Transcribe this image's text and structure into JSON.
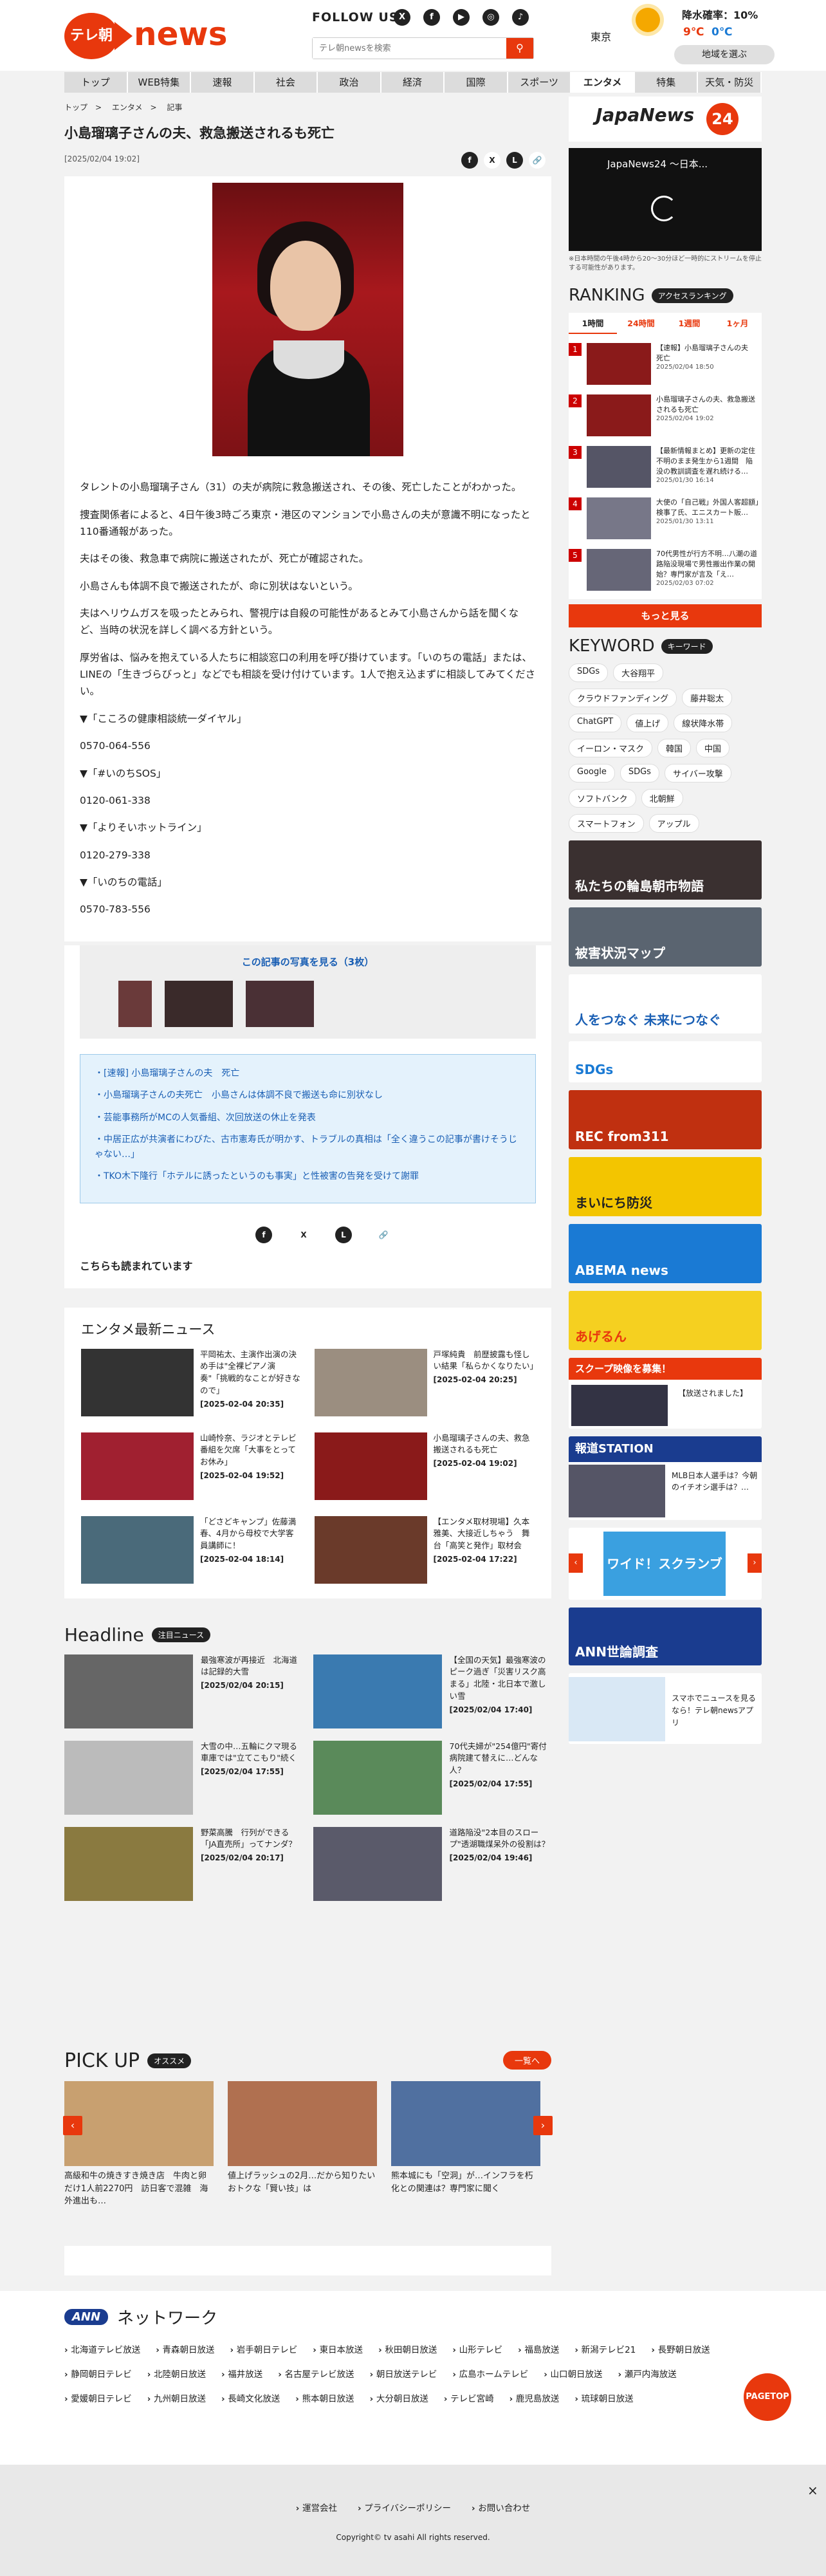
{
  "header": {
    "logo_badge": "テレ朝",
    "logo_word": "news",
    "follow": "FOLLOW US",
    "social": [
      "X",
      "f",
      "▶",
      "◎"
    ],
    "search_placeholder": "テレ朝newsを検索",
    "search_icon": "search-icon",
    "weather": {
      "city": "東京",
      "rain": "降水確率：10%",
      "high": "9℃",
      "low": "0℃",
      "change": "地域を選ぶ"
    }
  },
  "nav": [
    "トップ",
    "WEB特集",
    "速報",
    "社会",
    "政治",
    "経済",
    "国際",
    "スポーツ",
    "エンタメ",
    "特集",
    "天気・防災"
  ],
  "nav_active": "エンタメ",
  "breadcrumb": [
    "トップ",
    "エンタメ",
    "記事"
  ],
  "article": {
    "title": "小島瑠璃子さんの夫、救急搬送されるも死亡",
    "date": "[2025/02/04 19:02]",
    "paragraphs": [
      "タレントの小島瑠璃子さん（31）の夫が病院に救急搬送され、その後、死亡したことがわかった。",
      "捜査関係者によると、4日午後3時ごろ東京・港区のマンションで小島さんの夫が意識不明になったと110番通報があった。",
      "夫はその後、救急車で病院に搬送されたが、死亡が確認された。",
      "小島さんも体調不良で搬送されたが、命に別状はないという。",
      "夫はヘリウムガスを吸ったとみられ、警視庁は自殺の可能性があるとみて小島さんから話を聞くなど、当時の状況を詳しく調べる方針という。",
      "厚労省は、悩みを抱えている人たちに相談窓口の利用を呼び掛けています。「いのちの電話」または、LINEの「生きづらびっと」などでも相談を受け付けています。1人で抱え込まずに相談してみてください。",
      "▼「こころの健康相談統一ダイヤル」",
      "0570-064-556",
      "▼「#いのちSOS」",
      "0120-061-338",
      "▼「よりそいホットライン」",
      "0120-279-338",
      "▼「いのちの電話」",
      "0570-783-556"
    ],
    "photos_link": "この記事の写真を見る（3枚）",
    "related": [
      "・[速報] 小島瑠璃子さんの夫　死亡",
      "・小島瑠璃子さんの夫死亡　小島さんは体調不良で搬送も命に別状なし",
      "・芸能事務所がMCの人気番組、次回放送の休止を発表",
      "・中居正広が共演者にわびた、古市憲寿氏が明かす、トラブルの真相は「全く違うこの記事が書けそうじゃない…」",
      "・TKO木下隆行「ホテルに誘ったというのも事実」と性被害の告発を受けて謝罪"
    ],
    "read_also": "こちらも読まれています"
  },
  "entame": {
    "heading": "エンタメ最新ニュース",
    "items": [
      {
        "t": "平岡祐太、主演作出演の決め手は\"全裸ピアノ演奏\"「挑戦的なことが好きなので」",
        "d": "[2025-02-04 20:35]",
        "c": "#333"
      },
      {
        "t": "戸塚純貴　前歴披露も怪しい結果「私らかくなりたい」",
        "d": "[2025-02-04 20:25]",
        "c": "#9b8e80"
      },
      {
        "t": "山崎怜奈、ラジオとテレビ番組を欠席「大事をとってお休み」",
        "d": "[2025-02-04 19:52]",
        "c": "#a02030"
      },
      {
        "t": "小島瑠璃子さんの夫、救急搬送されるも死亡",
        "d": "[2025-02-04 19:02]",
        "c": "#8a1a1a"
      },
      {
        "t": "「どさどキャンプ」佐藤満春、4月から母校で大学客員講師に！",
        "d": "[2025-02-04 18:14]",
        "c": "#4a6a7a"
      },
      {
        "t": "【エンタメ取材現場】久本雅美、大接近しちゃう　舞台「高笑と発作」取材会",
        "d": "[2025-02-04 17:22]",
        "c": "#6a3a2a"
      }
    ]
  },
  "headline": {
    "heading": "Headline",
    "badge": "注目ニュース",
    "items": [
      {
        "t": "最強寒波が再接近　北海道は記録的大雪",
        "d": "[2025/02/04 20:15]",
        "c": "#666"
      },
      {
        "t": "【全国の天気】最強寒波のピーク過ぎ「災害リスク高まる」北陸・北日本で激しい雪",
        "d": "[2025/02/04 17:40]",
        "c": "#3a7ab0"
      },
      {
        "t": "大雪の中…五輪にクマ現る　車庫では\"立てこもり\"続く",
        "d": "[2025/02/04 17:55]",
        "c": "#bbb"
      },
      {
        "t": "70代夫婦が\"254億円\"寄付　病院建て替えに…どんな人？",
        "d": "[2025/02/04 17:55]",
        "c": "#5a8a5a"
      },
      {
        "t": "野菜高騰　行列ができる「JA直売所」ってナンダ？",
        "d": "[2025/02/04 20:17]",
        "c": "#8a7a40"
      },
      {
        "t": "道路陥没\"2本目のスロープ\"透湖職煤呆外の役割は？",
        "d": "[2025/02/04 19:46]",
        "c": "#5a5a6a"
      }
    ]
  },
  "sidebar": {
    "japan_news": "JapaNews",
    "japan_24": "24",
    "video_title": "JapaNews24 ～日本...",
    "video_note": "※日本時間の午後4時から20～30分ほど一時的にストリームを停止する可能性があります。",
    "ranking": "RANKING",
    "ranking_badge": "アクセスランキング",
    "rank_tabs": [
      "1時間",
      "24時間",
      "1週間",
      "1ヶ月"
    ],
    "rank_active": "1時間",
    "rank_items": [
      {
        "n": "1",
        "t": "【速報】小島瑠璃子さんの夫　死亡",
        "d": "2025/02/04 18:50",
        "c": "#8a1a1a"
      },
      {
        "n": "2",
        "t": "小島瑠璃子さんの夫、救急搬送されるも死亡",
        "d": "2025/02/04 19:02",
        "c": "#8a1a1a"
      },
      {
        "n": "3",
        "t": "【最新情報まとめ】更新の定住不明のまま発生から1週間　陥没の教訓調査を遅れ続ける…",
        "d": "2025/01/30 16:14",
        "c": "#556"
      },
      {
        "n": "4",
        "t": "大使の「自己戦」外国人客超額」検事了氏、エニスカート販…",
        "d": "2025/01/30 13:11",
        "c": "#778"
      },
      {
        "n": "5",
        "t": "70代男性が行方不明…八潮の道路陥没現場で男性搬出作業の開始？専門家が言及「え…",
        "d": "2025/02/03 07:02",
        "c": "#667"
      }
    ],
    "more": "もっと見る",
    "keyword": "KEYWORD",
    "keyword_badge": "キーワード",
    "keywords": [
      "SDGs",
      "大谷翔平",
      "クラウドファンディング",
      "藤井聡太",
      "ChatGPT",
      "値上げ",
      "線状降水帯",
      "イーロン・マスク",
      "韓国",
      "中国",
      "Google",
      "SDGs",
      "サイバー攻撃",
      "ソフトバンク",
      "北朝鮮",
      "スマートフォン",
      "アップル"
    ],
    "banners": [
      {
        "label": "私たちの輪島朝市物語",
        "bg": "#3a3030",
        "fg": "#fff"
      },
      {
        "label": "被害状況マップ",
        "bg": "#5a6470",
        "fg": "#fff"
      },
      {
        "label": "人をつなぐ 未来につなぐ",
        "bg": "#ffffff",
        "fg": "#1a5fb4"
      },
      {
        "label": "SDGs",
        "bg": "#ffffff",
        "fg": "#1a7ad4"
      },
      {
        "label": "REC from311",
        "bg": "#c03010",
        "fg": "#fff"
      },
      {
        "label": "まいにち防災",
        "bg": "#f3c500",
        "fg": "#222"
      },
      {
        "label": "ABEMA news",
        "bg": "#1a7ad4",
        "fg": "#fff"
      },
      {
        "label": "あげるん",
        "bg": "#f5d020",
        "fg": "#e8380d"
      }
    ],
    "scoop": "スクープ映像を募集！",
    "scoop_sub": "【放送されました】",
    "hodo": "報道STATION",
    "hodo_sub": "MLB日本人選手は？今朝のイチオシ選手は？…",
    "wide": "ワイド！スクランブル",
    "ann_poll": "ANN世論調査",
    "app": "スマホでニュースを見るなら！テレ朝newsアプリ"
  },
  "pickup": {
    "heading": "PICK UP",
    "badge": "オススメ",
    "all": "一覧へ",
    "items": [
      {
        "t": "高級和牛の焼きすき焼き店　牛肉と卵だけ1人前2270円　訪日客で混雑　海外進出も…",
        "c": "#c8a070"
      },
      {
        "t": "値上げラッシュの2月…だから知りたいおトクな「賢い技」は",
        "c": "#b07050"
      },
      {
        "t": "熊本城にも「空洞」が…インフラを朽化との関連は？専門家に聞く",
        "c": "#5070a0"
      }
    ]
  },
  "ann": {
    "brand": "ANN",
    "heading": "ネットワーク",
    "stations": [
      "北海道テレビ放送",
      "青森朝日放送",
      "岩手朝日テレビ",
      "東日本放送",
      "秋田朝日放送",
      "山形テレビ",
      "福島放送",
      "新潟テレビ21",
      "長野朝日放送",
      "静岡朝日テレビ",
      "北陸朝日放送",
      "福井放送",
      "名古屋テレビ放送",
      "朝日放送テレビ",
      "広島ホームテレビ",
      "山口朝日放送",
      "瀬戸内海放送",
      "愛媛朝日テレビ",
      "九州朝日放送",
      "長崎文化放送",
      "熊本朝日放送",
      "大分朝日放送",
      "テレビ宮崎",
      "鹿児島放送",
      "琉球朝日放送"
    ]
  },
  "pagetop": "PAGETOP",
  "footer": {
    "links": [
      "運営会社",
      "プライバシーポリシー",
      "お問い合わせ"
    ],
    "copyright": "Copyright© tv asahi All rights reserved."
  }
}
